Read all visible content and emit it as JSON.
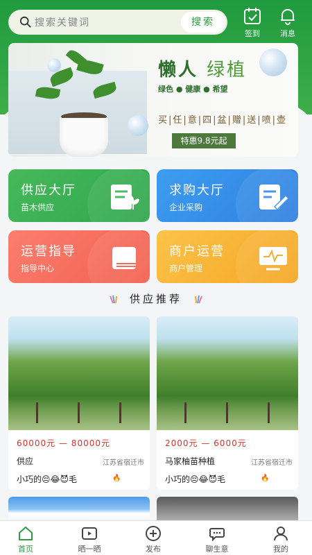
{
  "search": {
    "placeholder": "搜索关键词",
    "button": "搜索"
  },
  "topbar": {
    "signin_label": "签到",
    "message_label": "消息"
  },
  "banner": {
    "title_bold": "懒人",
    "title_light": "绿植",
    "subtitle": "绿色 ● 健康 ● 希望",
    "slogan": "买|任|意|四|盆|赠|送|喷|壶",
    "price": "特惠9.8元起"
  },
  "tiles": [
    {
      "title": "供应大厅",
      "sub": "苗木供应",
      "color": "#3fb35a"
    },
    {
      "title": "求购大厅",
      "sub": "企业采购",
      "color": "#3a8ee8"
    },
    {
      "title": "运营指导",
      "sub": "指导中心",
      "color": "#f76e61"
    },
    {
      "title": "商户运营",
      "sub": "商户管理",
      "color": "#f7b53a"
    }
  ],
  "section": {
    "title": "供应推荐"
  },
  "cards": [
    {
      "price": "60000元 — 80000元",
      "name": "供应",
      "location": "江苏省宿迁市",
      "user": "小巧的😔😂😈毛"
    },
    {
      "price": "2000元 — 6000元",
      "name": "马家柚苗种植",
      "location": "江苏省宿迁市",
      "user": "小巧的😔😂😈毛"
    }
  ],
  "tabs": [
    {
      "label": "首页",
      "icon": "home-icon"
    },
    {
      "label": "晒一晒",
      "icon": "video-icon"
    },
    {
      "label": "发布",
      "icon": "plus-circle-icon"
    },
    {
      "label": "聊生意",
      "icon": "chat-icon"
    },
    {
      "label": "我的",
      "icon": "user-icon"
    }
  ],
  "colors": {
    "primary": "#2a9d3d",
    "price": "#d6332b"
  }
}
